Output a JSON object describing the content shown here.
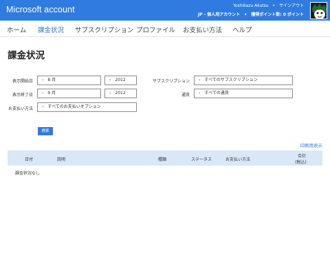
{
  "header": {
    "brand": "Microsoft account",
    "user_name": "Yoshikazu Akutsu",
    "signout": "サインアウト",
    "account_type": "JP - 個人用アカウント",
    "points": "獲得ポイント数: 0 ポイント"
  },
  "nav": {
    "items": [
      "ホーム",
      "課金状況",
      "サブスクリプション",
      "プロファイル",
      "お支払い方法",
      "ヘルプ"
    ],
    "active_index": 1
  },
  "page": {
    "title": "課金状況"
  },
  "filters": {
    "start_label": "表示開始日",
    "start_month": "8 月",
    "start_year": "2012",
    "end_label": "表示終了日",
    "end_month": "9 月",
    "end_year": "2012",
    "payment_label": "お支払い方法",
    "payment_value": "すべてのお支払いオプション",
    "subscription_label": "サブスクリプション",
    "subscription_value": "すべてのサブスクリプション",
    "currency_label": "通貨",
    "currency_value": "すべての通貨",
    "search_label": "検索"
  },
  "print_link": "印刷用表示",
  "table": {
    "columns": [
      "日付",
      "説明",
      "種類",
      "ステータス",
      "お支払い方法",
      "合計",
      "(税込)"
    ],
    "empty_message": "課金状況なし"
  },
  "colors": {
    "accent": "#2f7be0",
    "table_header": "#d9e7f7"
  }
}
